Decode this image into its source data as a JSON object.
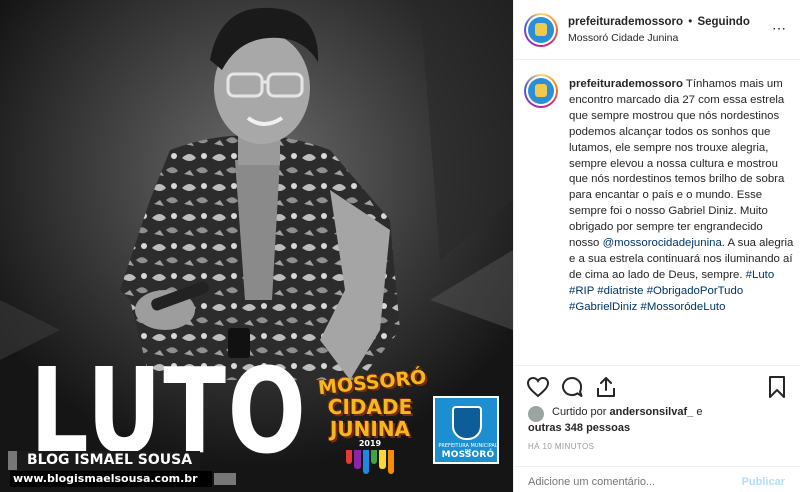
{
  "post": {
    "overlay_text": "LUTO",
    "festival_logo": {
      "lines": [
        "MOSSORÓ",
        "CIDADE",
        "JUNINA",
        "2019"
      ],
      "colors": [
        "#e53935",
        "#8e24aa",
        "#1e88e5",
        "#43a047",
        "#fdd835",
        "#fb8c00"
      ]
    },
    "city_logo": {
      "subtitle": "PREFEITURA MUNICIPAL DE",
      "name": "MOSSORÓ"
    },
    "watermark": {
      "title": "BLOG ISMAEL SOUSA",
      "url": "www.blogismaelsousa.com.br"
    }
  },
  "header": {
    "username": "prefeiturademossoro",
    "separator": "•",
    "follow_status": "Seguindo",
    "location": "Mossoró Cidade Junina",
    "more_icon": "⋯"
  },
  "caption": {
    "username": "prefeiturademossoro",
    "part1": "Tínhamos mais um encontro marcado dia 27 com essa estrela que sempre mostrou que nós nordestinos podemos alcançar todos os sonhos que lutamos, ele sempre nos trouxe alegria, sempre elevou a nossa cultura e mostrou que nós nordestinos temos brilho de sobra para encantar o país e o mundo. Esse sempre foi o nosso Gabriel Diniz. Muito obrigado por sempre ter engrandecido nosso",
    "mention": "@mossorocidadejunina",
    "part2": ". A sua alegria e a sua estrela continuará nos iluminando aí de cima ao lado de Deus, sempre.",
    "hashtags": [
      "#Luto",
      "#RIP",
      "#diatriste",
      "#ObrigadoPorTudo",
      "#GabrielDiniz",
      "#MossoródeLuto"
    ]
  },
  "likes": {
    "prefix": "Curtido por",
    "user": "andersonsilvaf_",
    "joiner": "e",
    "others": "outras 348 pessoas"
  },
  "timestamp": "HÁ 10 MINUTOS",
  "comment": {
    "placeholder": "Adicione um comentário...",
    "publish_label": "Publicar"
  },
  "colors": {
    "link": "#003569",
    "publish_disabled": "#b2dffc",
    "text": "#262626"
  }
}
